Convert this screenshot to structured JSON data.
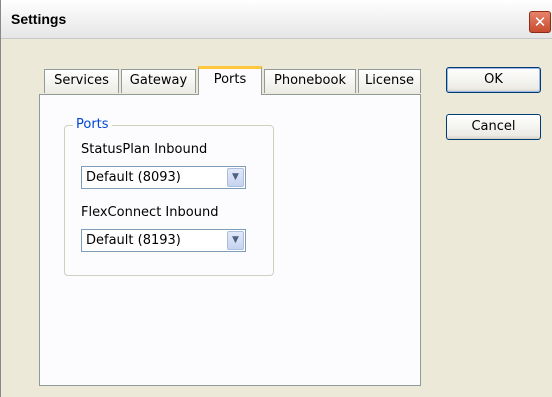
{
  "window": {
    "title": "Settings",
    "close_glyph": "✕"
  },
  "tabs": [
    {
      "label": "Services"
    },
    {
      "label": "Gateway"
    },
    {
      "label": "Ports",
      "active": true
    },
    {
      "label": "Phonebook"
    },
    {
      "label": "License"
    }
  ],
  "ports": {
    "group_title": "Ports",
    "statusplan_label": "StatusPlan Inbound",
    "statusplan_value": "Default (8093)",
    "flexconnect_label": "FlexConnect Inbound",
    "flexconnect_value": "Default (8193)",
    "dropdown_glyph": "▼"
  },
  "buttons": {
    "ok": "OK",
    "cancel": "Cancel"
  },
  "colors": {
    "active_tab_accent": "#ffc83c",
    "group_title": "#0046d5",
    "close_button": "#c74b2f"
  }
}
